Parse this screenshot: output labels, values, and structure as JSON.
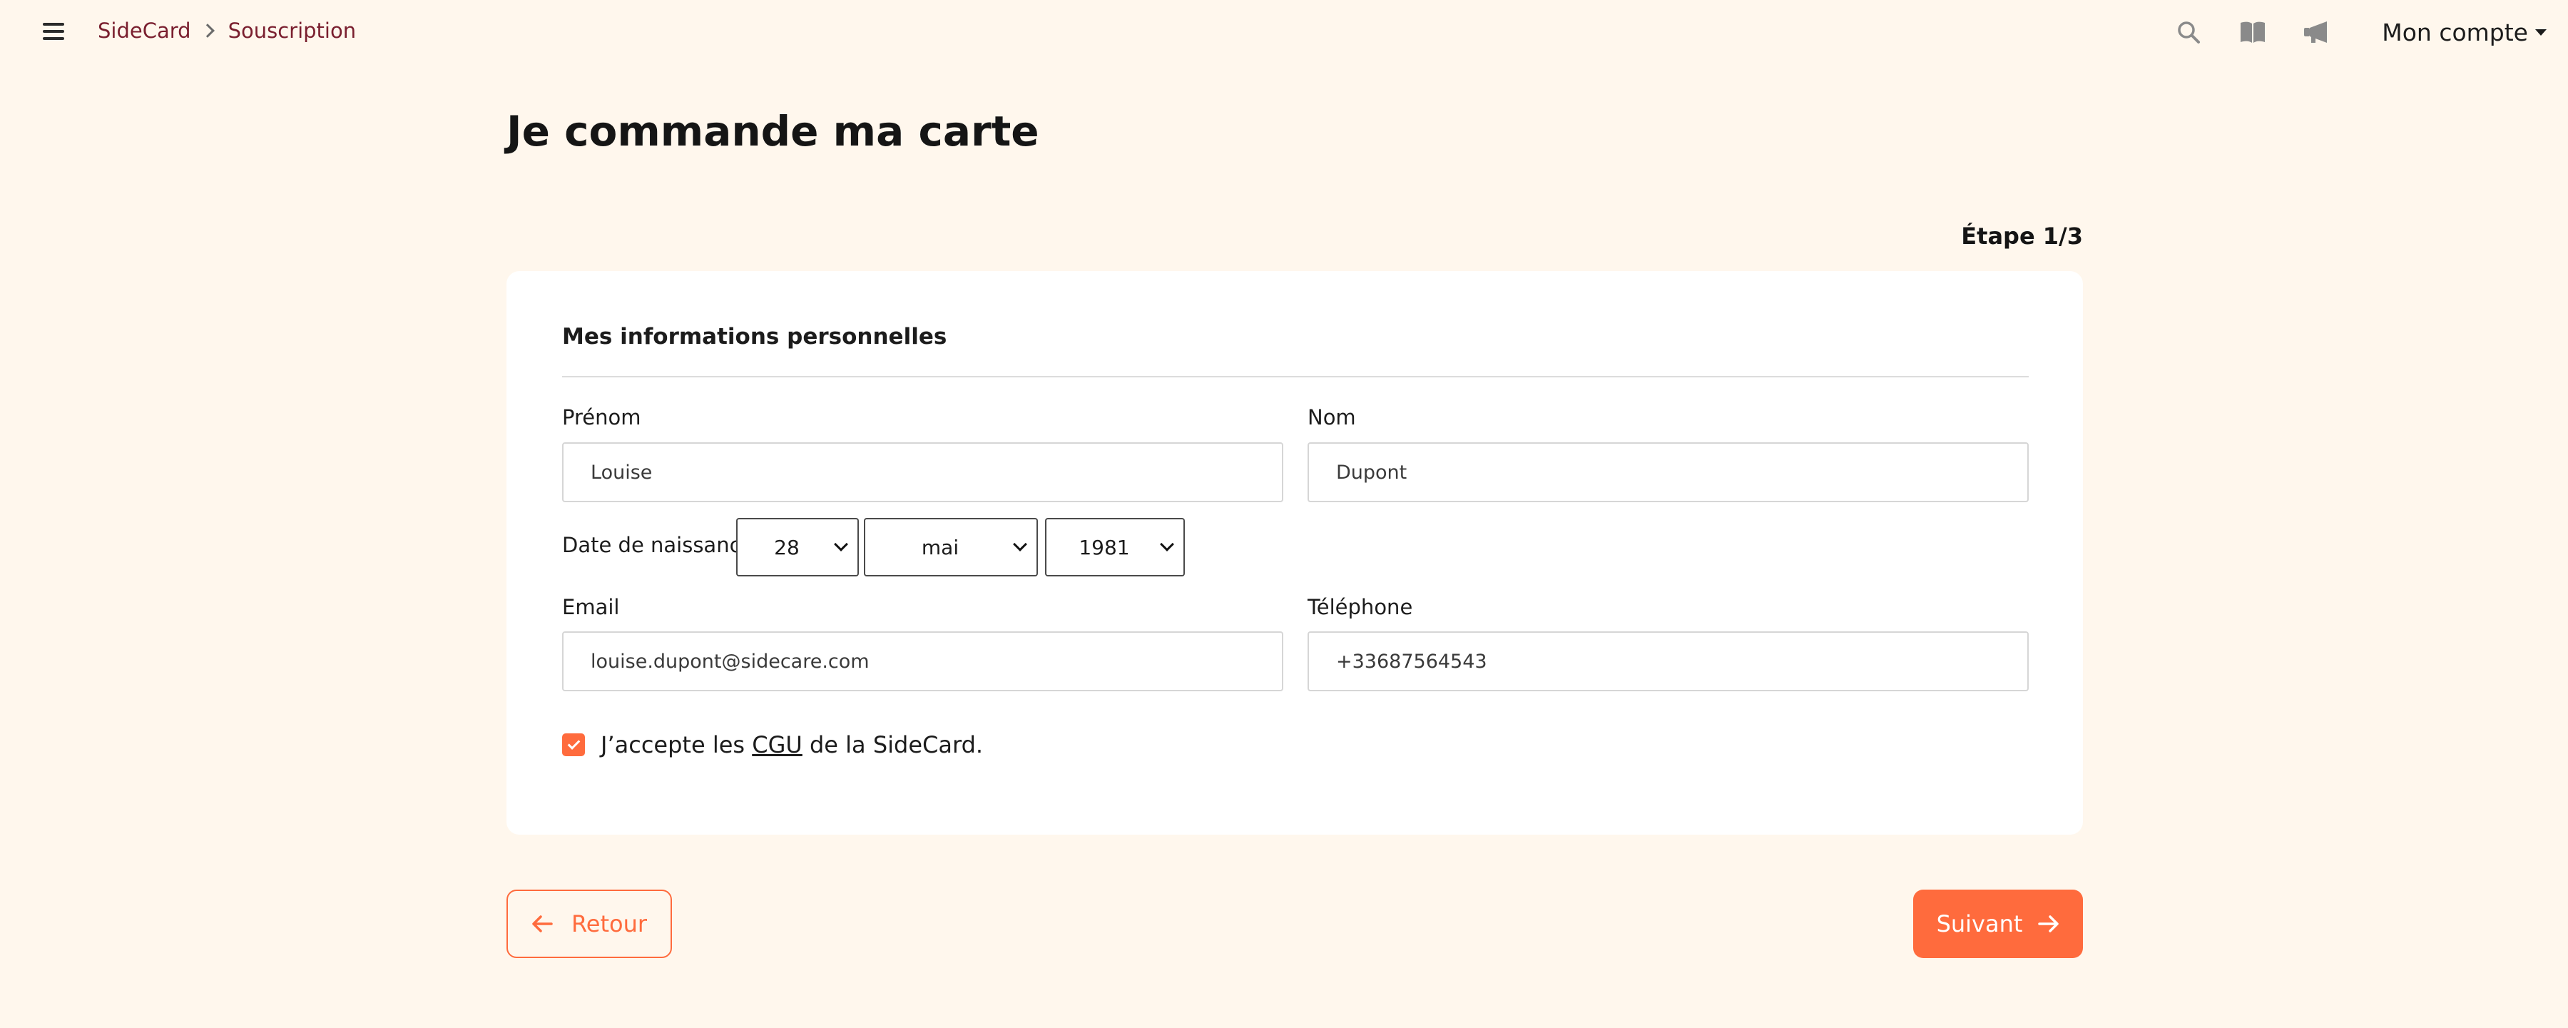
{
  "header": {
    "breadcrumb": [
      "SideCard",
      "Souscription"
    ],
    "icons": [
      "search-icon",
      "book-icon",
      "megaphone-icon"
    ],
    "account_label": "Mon compte"
  },
  "page": {
    "title": "Je commande ma carte",
    "step": "Étape 1/3"
  },
  "form": {
    "section_title": "Mes informations personnelles",
    "first_name": {
      "label": "Prénom",
      "value": "Louise"
    },
    "last_name": {
      "label": "Nom",
      "value": "Dupont"
    },
    "birth_date": {
      "label": "Date de naissance",
      "day": "28",
      "month": "mai",
      "year": "1981"
    },
    "email": {
      "label": "Email",
      "value": "louise.dupont@sidecare.com"
    },
    "phone": {
      "label": "Téléphone",
      "value": "+33687564543"
    },
    "consent": {
      "prefix": "J’accepte les ",
      "link": "CGU",
      "suffix": " de la SideCard.",
      "checked": true
    }
  },
  "actions": {
    "back_label": "Retour",
    "next_label": "Suivant"
  },
  "colors": {
    "background": "#fff7ed",
    "accent": "#ff6b3d",
    "breadcrumb": "#7a1f2f"
  }
}
